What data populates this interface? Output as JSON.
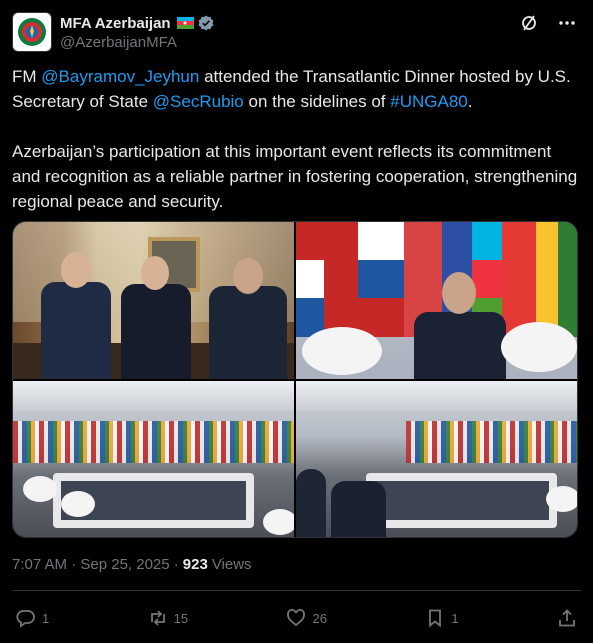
{
  "account": {
    "display_name": "MFA Azerbaijan",
    "handle": "@AzerbaijanMFA",
    "avatar_icon": "mfa-emblem-icon",
    "flag_icon": "azerbaijan-flag-icon",
    "verified_icon": "verified-badge-icon"
  },
  "tweet": {
    "p1_prefix": "FM ",
    "mention1": "@Bayramov_Jeyhun",
    "p1_mid": " attended the Transatlantic Dinner hosted by U.S. Secretary of State ",
    "mention2": "@SecRubio",
    "p1_mid2": " on the sidelines of ",
    "hashtag": "#UNGA80",
    "p1_suffix": ".",
    "p2": "Azerbaijan’s participation at this important event reflects its commitment and recognition as a reliable partner in fostering cooperation, strengthening regional peace and security."
  },
  "meta": {
    "timestamp": "7:07 AM · Sep 25, 2025 · ",
    "views_count": "923",
    "views_label": " Views"
  },
  "actions": {
    "replies": "1",
    "reposts": "15",
    "likes": "26",
    "bookmarks": "1"
  },
  "colors": {
    "background": "#000000",
    "link": "#1d9bf0",
    "secondary_text": "#71767b",
    "primary_text": "#e7e9ea",
    "verified": "#829aab"
  }
}
